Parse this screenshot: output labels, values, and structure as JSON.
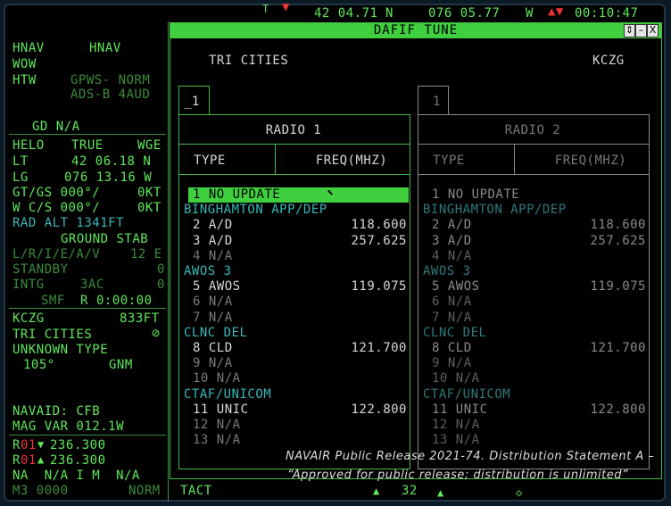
{
  "topbar": {
    "left_marker": "T",
    "lat": "42 04.71",
    "lat_hemi": "N",
    "lon": "076 05.77",
    "lon_hemi": "W",
    "time": "00:10:47"
  },
  "left_panel": {
    "nav1": "HNAV",
    "nav2": "HNAV",
    "line_wow": "WOW",
    "line_htw_a": "HTW",
    "line_htw_b": "GPWS- NORM",
    "line_adsb": "ADS-B 4AUD",
    "gd": "GD N/A",
    "helo": "HELO",
    "true": "TRUE",
    "wge": "WGE",
    "lt_label": "LT",
    "lt_val": "42 06.18 N",
    "lg_label": "LG",
    "lg_val": "076 13.16 W",
    "gtgs_label": "GT/GS 000°/",
    "gtgs_val": "0KT",
    "wcs_label": "W C/S 000°/",
    "wcs_val": "0KT",
    "rad_alt": "RAD ALT 1341FT",
    "ground_stab": "GROUND STAB",
    "lriav": "L/R/I/E/A/V",
    "lriav_val": "12 E",
    "standby": "STANDBY",
    "standby_val": "0",
    "intg": "INTG",
    "intg_code": "3AC",
    "intg_val": "0",
    "smf": "SMF",
    "smf_r": "R",
    "smf_time": "0:00:00",
    "kczg": "KCZG",
    "elev": "833FT",
    "tri_cities": "TRI CITIES",
    "unknown_type": "UNKNOWN TYPE",
    "bearing": "105°",
    "gnm": "GNM",
    "navaid": "NAVAID: CFB",
    "magvar": "MAG VAR 012.1W",
    "r01a_prefix": "R",
    "r01a_num": "01",
    "r01a_freq": "236.300",
    "r01b_prefix": "R",
    "r01b_num": "01",
    "r01b_freq": "236.300",
    "na_row": "NA  N/A I M  N/A",
    "m3_label": "M3 0000",
    "m3_norm": "NORM",
    "tact": "TACT",
    "bottom_num": "32"
  },
  "dialog": {
    "title": "DAFIF TUNE",
    "location_name": "TRI CITIES",
    "location_code": "KCZG",
    "radio1": {
      "tab": "_1",
      "label": "RADIO 1",
      "col_type": "TYPE",
      "col_freq": "FREQ(MHZ)"
    },
    "radio2": {
      "tab": "1",
      "label": "RADIO 2",
      "col_type": "TYPE",
      "col_freq": "FREQ(MHZ)"
    },
    "rows": [
      {
        "kind": "sel",
        "text": "1 NO UPDATE",
        "freq": ""
      },
      {
        "kind": "group",
        "text": "BINGHAMTON APP/DEP",
        "freq": ""
      },
      {
        "kind": "item",
        "text": "2 A/D",
        "freq": "118.600"
      },
      {
        "kind": "item",
        "text": "3 A/D",
        "freq": "257.625"
      },
      {
        "kind": "na",
        "text": "4 N/A",
        "freq": ""
      },
      {
        "kind": "group",
        "text": "AWOS 3",
        "freq": ""
      },
      {
        "kind": "item",
        "text": "5 AWOS",
        "freq": "119.075"
      },
      {
        "kind": "na",
        "text": "6 N/A",
        "freq": ""
      },
      {
        "kind": "na",
        "text": "7 N/A",
        "freq": ""
      },
      {
        "kind": "group",
        "text": "CLNC DEL",
        "freq": ""
      },
      {
        "kind": "item",
        "text": "8 CLD",
        "freq": "121.700"
      },
      {
        "kind": "na",
        "text": "9 N/A",
        "freq": ""
      },
      {
        "kind": "na",
        "text": "10 N/A",
        "freq": ""
      },
      {
        "kind": "group",
        "text": "CTAF/UNICOM",
        "freq": ""
      },
      {
        "kind": "item",
        "text": "11 UNIC",
        "freq": "122.800"
      },
      {
        "kind": "na",
        "text": "12 N/A",
        "freq": ""
      },
      {
        "kind": "na",
        "text": "13 N/A",
        "freq": ""
      }
    ]
  },
  "footer": {
    "line1": "NAVAIR Public Release 2021-74. Distribution Statement A –",
    "line2": "“Approved for public release; distribution is unlimited”"
  }
}
